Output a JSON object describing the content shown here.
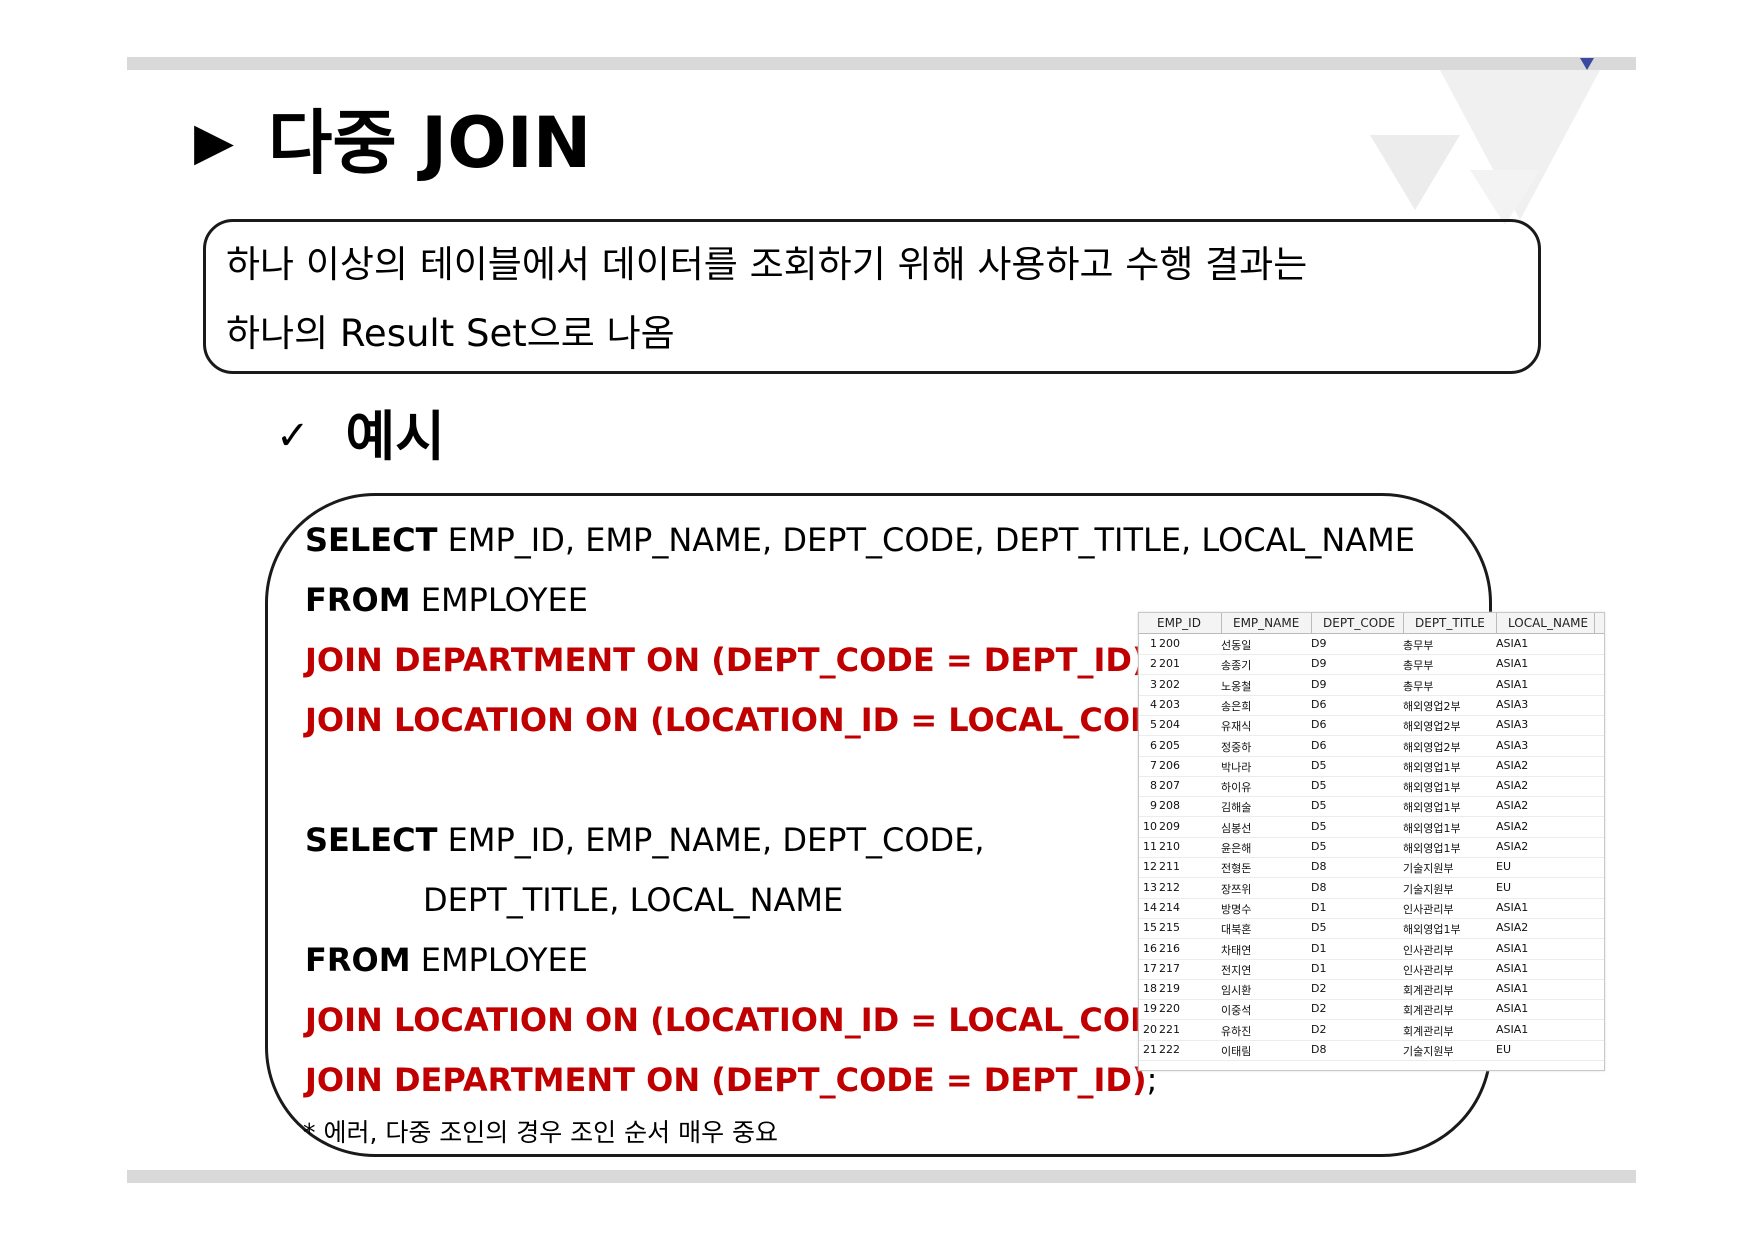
{
  "title": {
    "arrow": "▶",
    "text": "다중 JOIN"
  },
  "definition": {
    "line1": "하나 이상의 테이블에서 데이터를 조회하기 위해 사용하고 수행 결과는",
    "line2": "하나의 Result Set으로 나옴"
  },
  "example": {
    "check": "✓",
    "label": "예시"
  },
  "query1": {
    "select_kw": "SELECT",
    "select_cols": " EMP_ID, EMP_NAME, DEPT_CODE, DEPT_TITLE, LOCAL_NAME",
    "from_kw": "FROM",
    "from_table": " EMPLOYEE",
    "join1": "JOIN DEPARTMENT ON (DEPT_CODE  =  DEPT_ID)",
    "join2": "JOIN LOCATION ON (LOCATION_ID  =  LOCAL_CODE)",
    "join2_semi": ";"
  },
  "query2": {
    "select_kw": "SELECT",
    "select_cols": " EMP_ID, EMP_NAME, DEPT_CODE,",
    "select_cols2": "DEPT_TITLE, LOCAL_NAME",
    "from_kw": "FROM",
    "from_table": " EMPLOYEE",
    "join1": "JOIN LOCATION ON (LOCATION_ID  =  LOCAL_CODE)",
    "join2": "JOIN DEPARTMENT ON (DEPT_CODE  =  DEPT_ID)",
    "join2_semi": ";"
  },
  "note": "* 에러, 다중 조인의 경우 조인 순서 매우 중요",
  "result": {
    "headers": [
      "EMP_ID",
      "EMP_NAME",
      "DEPT_CODE",
      "DEPT_TITLE",
      "LOCAL_NAME"
    ],
    "rows": [
      [
        "1",
        "200",
        "선동일",
        "D9",
        "총무부",
        "ASIA1"
      ],
      [
        "2",
        "201",
        "송종기",
        "D9",
        "총무부",
        "ASIA1"
      ],
      [
        "3",
        "202",
        "노옹철",
        "D9",
        "총무부",
        "ASIA1"
      ],
      [
        "4",
        "203",
        "송은희",
        "D6",
        "해외영업2부",
        "ASIA3"
      ],
      [
        "5",
        "204",
        "유재식",
        "D6",
        "해외영업2부",
        "ASIA3"
      ],
      [
        "6",
        "205",
        "정중하",
        "D6",
        "해외영업2부",
        "ASIA3"
      ],
      [
        "7",
        "206",
        "박나라",
        "D5",
        "해외영업1부",
        "ASIA2"
      ],
      [
        "8",
        "207",
        "하이유",
        "D5",
        "해외영업1부",
        "ASIA2"
      ],
      [
        "9",
        "208",
        "김해술",
        "D5",
        "해외영업1부",
        "ASIA2"
      ],
      [
        "10",
        "209",
        "심봉선",
        "D5",
        "해외영업1부",
        "ASIA2"
      ],
      [
        "11",
        "210",
        "윤은해",
        "D5",
        "해외영업1부",
        "ASIA2"
      ],
      [
        "12",
        "211",
        "전형돈",
        "D8",
        "기술지원부",
        "EU"
      ],
      [
        "13",
        "212",
        "장쯔위",
        "D8",
        "기술지원부",
        "EU"
      ],
      [
        "14",
        "214",
        "방명수",
        "D1",
        "인사관리부",
        "ASIA1"
      ],
      [
        "15",
        "215",
        "대북혼",
        "D5",
        "해외영업1부",
        "ASIA2"
      ],
      [
        "16",
        "216",
        "차태연",
        "D1",
        "인사관리부",
        "ASIA1"
      ],
      [
        "17",
        "217",
        "전지연",
        "D1",
        "인사관리부",
        "ASIA1"
      ],
      [
        "18",
        "219",
        "임시환",
        "D2",
        "회계관리부",
        "ASIA1"
      ],
      [
        "19",
        "220",
        "이중석",
        "D2",
        "회계관리부",
        "ASIA1"
      ],
      [
        "20",
        "221",
        "유하진",
        "D2",
        "회계관리부",
        "ASIA1"
      ],
      [
        "21",
        "222",
        "이태림",
        "D8",
        "기술지원부",
        "EU"
      ]
    ]
  },
  "colors": {
    "accent_red": "#c00000",
    "bar_gray": "#d9d9d9",
    "deco_blue": "#3a4a9f"
  }
}
